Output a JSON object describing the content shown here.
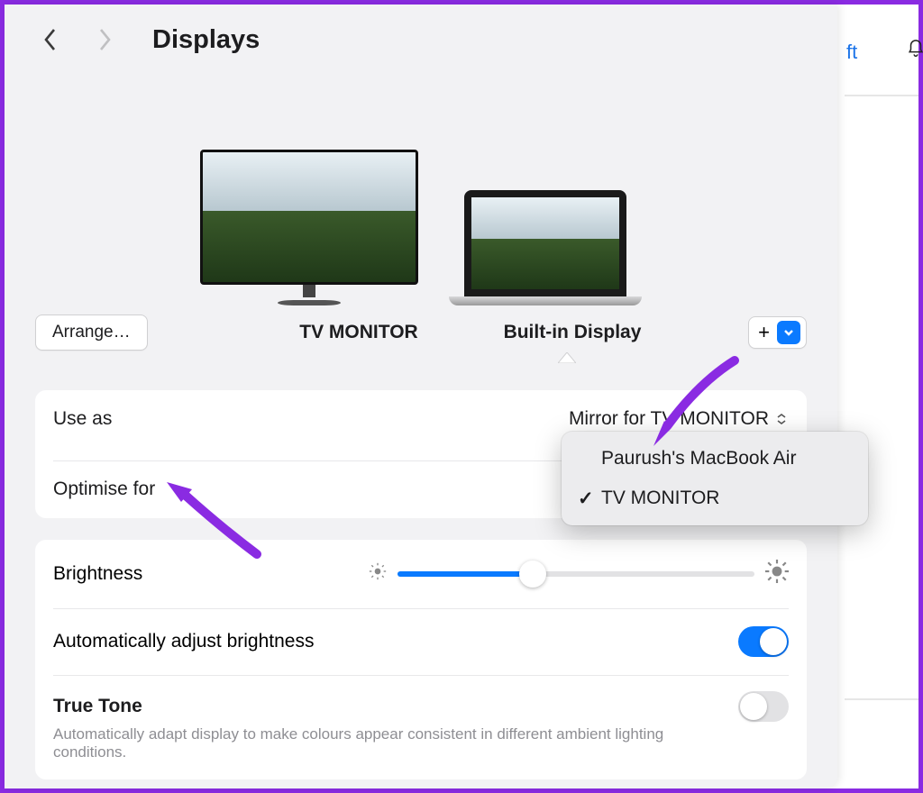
{
  "header": {
    "title": "Displays"
  },
  "behind": {
    "link_fragment": "ft"
  },
  "previews": {
    "arrange_label": "Arrange…",
    "tv_label": "TV MONITOR",
    "builtin_label": "Built-in Display"
  },
  "useas": {
    "label": "Use as",
    "value": "Mirror for TV MONITOR"
  },
  "optimise": {
    "label": "Optimise for"
  },
  "brightness": {
    "label": "Brightness",
    "percent": 38
  },
  "auto_bright": {
    "label": "Automatically adjust brightness",
    "on": true
  },
  "true_tone": {
    "label": "True Tone",
    "desc": "Automatically adapt display to make colours appear consistent in different ambient lighting conditions.",
    "on": false
  },
  "popover": {
    "items": [
      {
        "label": "Paurush's MacBook Air",
        "checked": false
      },
      {
        "label": "TV MONITOR",
        "checked": true
      }
    ]
  }
}
